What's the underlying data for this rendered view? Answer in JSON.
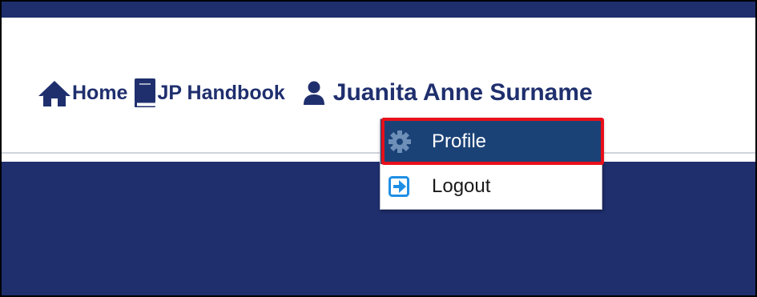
{
  "nav": {
    "home_label": "Home",
    "handbook_label": "JP Handbook",
    "user_name": "Juanita Anne Surname",
    "home_icon": "home-icon",
    "handbook_icon": "book-icon",
    "user_icon": "user-icon"
  },
  "dropdown": {
    "items": [
      {
        "label": "Profile",
        "icon": "gear-icon",
        "selected": true
      },
      {
        "label": "Logout",
        "icon": "logout-icon",
        "selected": false
      }
    ]
  },
  "colors": {
    "brand_navy": "#1f2f6e",
    "selected_item": "#1b4277",
    "highlight_red": "#e8101a",
    "logout_icon_blue": "#1f8fe5"
  }
}
